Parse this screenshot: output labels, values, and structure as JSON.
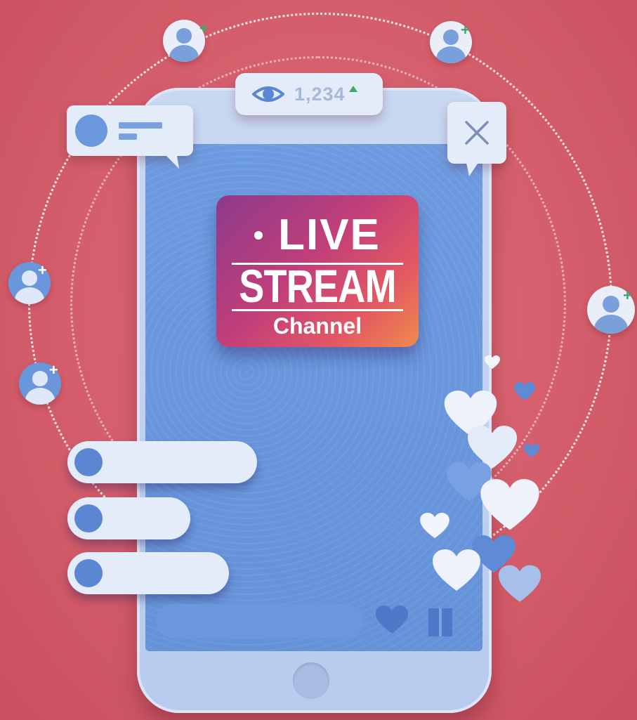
{
  "viewer_badge": {
    "count": "1,234",
    "icon": "eye-icon",
    "trend": "up-arrow-icon"
  },
  "live_card": {
    "line1": "LIVE",
    "line2": "STREAM",
    "line3": "Channel"
  },
  "colors": {
    "background": "#d45e6b",
    "phone": "#c9d8f2",
    "screen": "#6d9be0",
    "card_gradient_start": "#8c3a8c",
    "card_gradient_end": "#f08b4c",
    "accent_green": "#3ea86a"
  },
  "icons": [
    "eye-icon",
    "close-icon",
    "heart-icon",
    "gift-icon",
    "user-add-icon",
    "home-button"
  ]
}
